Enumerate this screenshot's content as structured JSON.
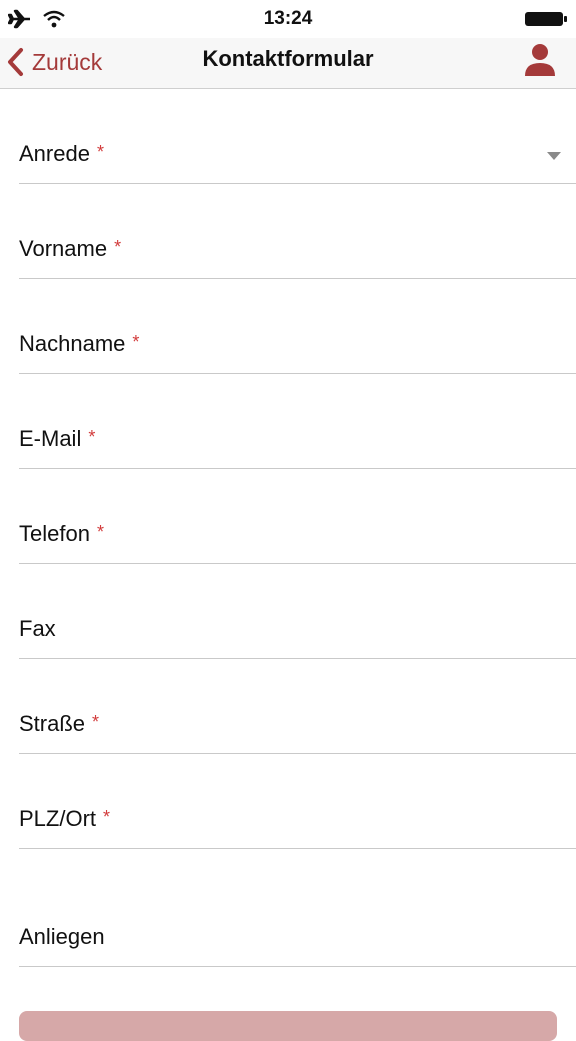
{
  "status_bar": {
    "time": "13:24"
  },
  "nav": {
    "back_label": "Zurück",
    "title": "Kontaktformular",
    "accent_color": "#a43a3a"
  },
  "form": {
    "required_mark": "*",
    "fields": [
      {
        "label": "Anrede",
        "required": true,
        "type": "select"
      },
      {
        "label": "Vorname",
        "required": true
      },
      {
        "label": "Nachname",
        "required": true
      },
      {
        "label": "E-Mail",
        "required": true
      },
      {
        "label": "Telefon",
        "required": true
      },
      {
        "label": "Fax",
        "required": false
      },
      {
        "label": "Straße",
        "required": true
      },
      {
        "label": "PLZ/Ort",
        "required": true
      },
      {
        "label": "Anliegen",
        "required": false
      }
    ]
  }
}
